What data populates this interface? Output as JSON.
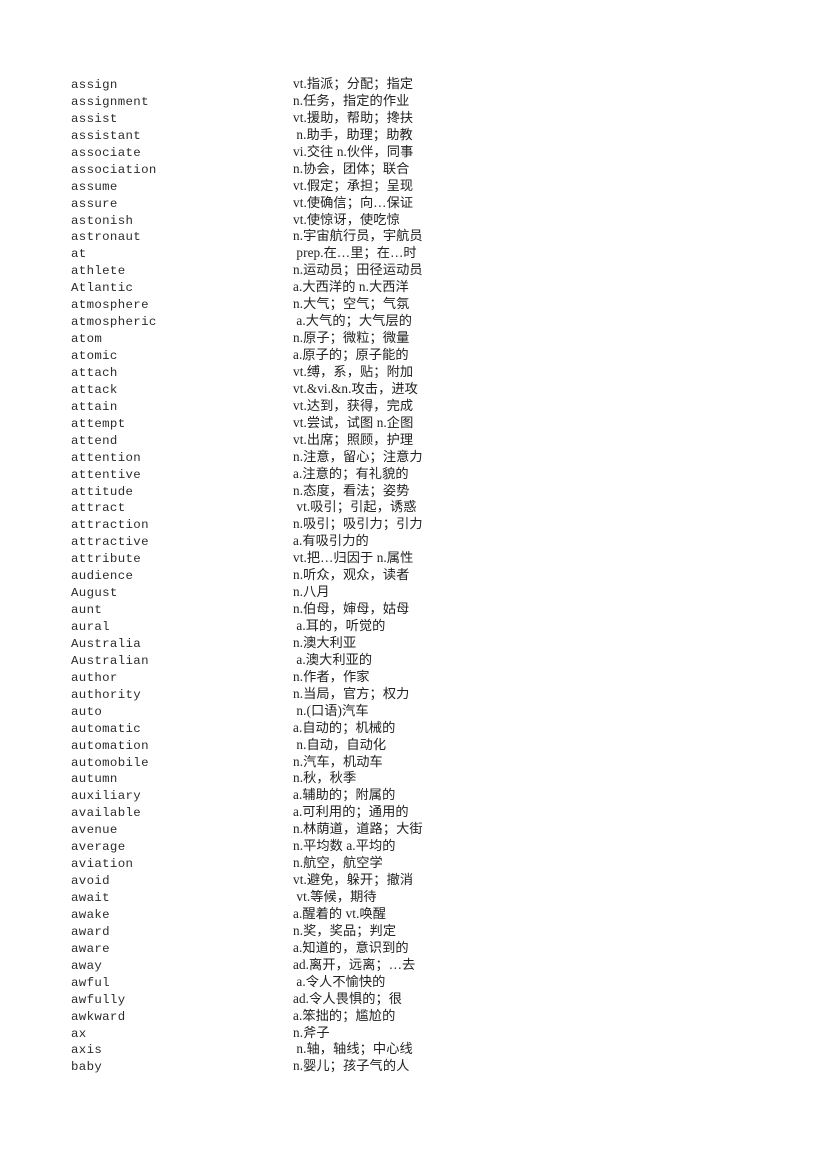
{
  "page": {
    "background_color": "#ffffff",
    "text_color": "#262626",
    "document_type": "vocabulary-word-list",
    "columns": {
      "term_header": "",
      "definition_header": ""
    }
  },
  "entries": [
    {
      "term": "assign",
      "definition": "vt.指派；分配；指定"
    },
    {
      "term": "assignment",
      "definition": "n.任务，指定的作业"
    },
    {
      "term": "assist",
      "definition": "vt.援助，帮助；搀扶"
    },
    {
      "term": "assistant",
      "definition": " n.助手，助理；助教"
    },
    {
      "term": "associate",
      "definition": "vi.交往 n.伙伴，同事"
    },
    {
      "term": "association",
      "definition": "n.协会，团体；联合"
    },
    {
      "term": "assume",
      "definition": "vt.假定；承担；呈现"
    },
    {
      "term": "assure",
      "definition": "vt.使确信；向…保证"
    },
    {
      "term": "astonish",
      "definition": "vt.使惊讶，使吃惊"
    },
    {
      "term": "astronaut",
      "definition": "n.宇宙航行员，宇航员"
    },
    {
      "term": "at",
      "definition": " prep.在…里；在…时"
    },
    {
      "term": "athlete",
      "definition": "n.运动员；田径运动员"
    },
    {
      "term": "Atlantic",
      "definition": "a.大西洋的 n.大西洋"
    },
    {
      "term": "atmosphere",
      "definition": "n.大气；空气；气氛"
    },
    {
      "term": "atmospheric",
      "definition": " a.大气的；大气层的"
    },
    {
      "term": "atom",
      "definition": "n.原子；微粒；微量"
    },
    {
      "term": "atomic",
      "definition": "a.原子的；原子能的"
    },
    {
      "term": "attach",
      "definition": "vt.缚，系，贴；附加"
    },
    {
      "term": "attack",
      "definition": "vt.&vi.&n.攻击，进攻"
    },
    {
      "term": "attain",
      "definition": "vt.达到，获得，完成"
    },
    {
      "term": "attempt",
      "definition": "vt.尝试，试图 n.企图"
    },
    {
      "term": "attend",
      "definition": "vt.出席；照顾，护理"
    },
    {
      "term": "attention",
      "definition": "n.注意，留心；注意力"
    },
    {
      "term": "attentive",
      "definition": "a.注意的；有礼貌的"
    },
    {
      "term": "attitude",
      "definition": "n.态度，看法；姿势"
    },
    {
      "term": "attract",
      "definition": " vt.吸引；引起，诱惑"
    },
    {
      "term": "attraction",
      "definition": "n.吸引；吸引力；引力"
    },
    {
      "term": "attractive",
      "definition": "a.有吸引力的"
    },
    {
      "term": "attribute",
      "definition": "vt.把…归因于 n.属性"
    },
    {
      "term": "audience",
      "definition": "n.听众，观众，读者"
    },
    {
      "term": "August",
      "definition": "n.八月"
    },
    {
      "term": "aunt",
      "definition": "n.伯母，婶母，姑母"
    },
    {
      "term": "aural",
      "definition": " a.耳的，听觉的"
    },
    {
      "term": "Australia",
      "definition": "n.澳大利亚"
    },
    {
      "term": "Australian",
      "definition": " a.澳大利亚的"
    },
    {
      "term": "author",
      "definition": "n.作者，作家"
    },
    {
      "term": "authority",
      "definition": "n.当局，官方；权力"
    },
    {
      "term": "auto",
      "definition": " n.(口语)汽车"
    },
    {
      "term": "automatic",
      "definition": "a.自动的；机械的"
    },
    {
      "term": "automation",
      "definition": " n.自动，自动化"
    },
    {
      "term": "automobile",
      "definition": "n.汽车，机动车"
    },
    {
      "term": "autumn",
      "definition": "n.秋，秋季"
    },
    {
      "term": "auxiliary",
      "definition": "a.辅助的；附属的"
    },
    {
      "term": "available",
      "definition": "a.可利用的；通用的"
    },
    {
      "term": "avenue",
      "definition": "n.林荫道，道路；大街"
    },
    {
      "term": "average",
      "definition": "n.平均数 a.平均的"
    },
    {
      "term": "aviation",
      "definition": "n.航空，航空学"
    },
    {
      "term": "avoid",
      "definition": "vt.避免，躲开；撤消"
    },
    {
      "term": "await",
      "definition": " vt.等候，期待"
    },
    {
      "term": "awake",
      "definition": "a.醒着的 vt.唤醒"
    },
    {
      "term": "award",
      "definition": "n.奖，奖品；判定"
    },
    {
      "term": "aware",
      "definition": "a.知道的，意识到的"
    },
    {
      "term": "away",
      "definition": "ad.离开，远离；…去"
    },
    {
      "term": "awful",
      "definition": " a.令人不愉快的"
    },
    {
      "term": "awfully",
      "definition": "ad.令人畏惧的；很"
    },
    {
      "term": "awkward",
      "definition": "a.笨拙的；尴尬的"
    },
    {
      "term": "ax",
      "definition": "n.斧子"
    },
    {
      "term": "axis",
      "definition": " n.轴，轴线；中心线"
    },
    {
      "term": "baby",
      "definition": "n.婴儿；孩子气的人"
    }
  ]
}
